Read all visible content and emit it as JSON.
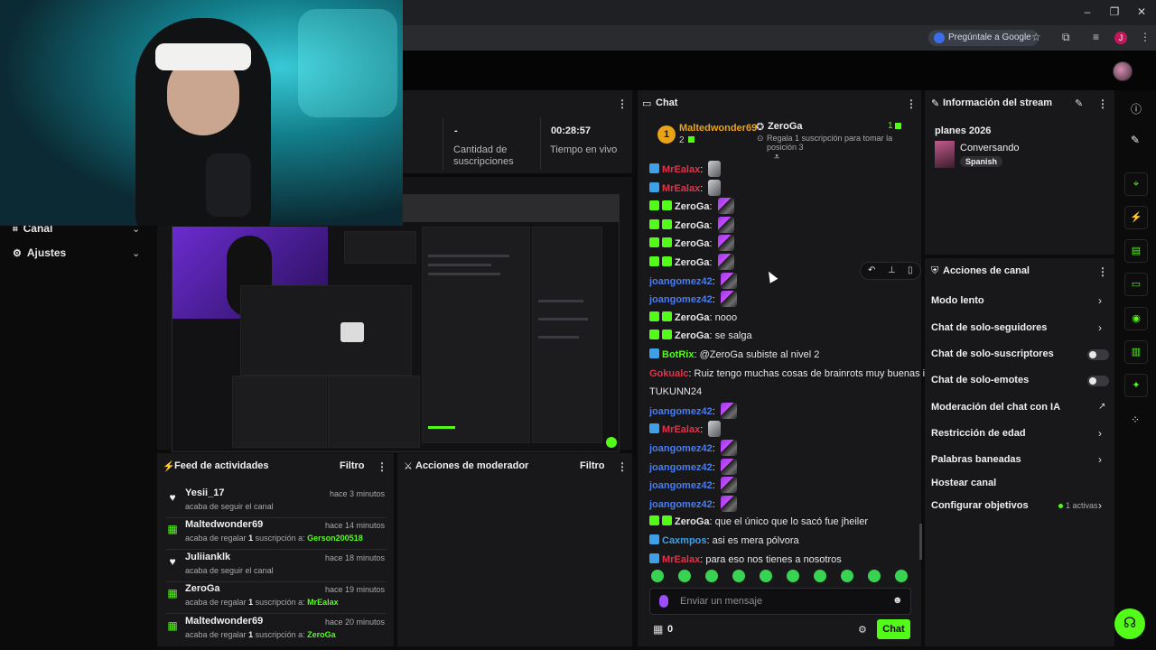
{
  "browser": {
    "ask_google": "Pregúntale a Google",
    "profile_initial": "J"
  },
  "sidebar": {
    "items": [
      {
        "label": "Canal",
        "icon": "channel-icon"
      },
      {
        "label": "Ajustes",
        "icon": "gear-icon"
      }
    ]
  },
  "stats": {
    "subs_value": "-",
    "subs_label": "Cantidad de suscripciones",
    "live_value": "00:28:57",
    "live_label": "Tiempo en vivo"
  },
  "activity_feed": {
    "title": "Feed de actividades",
    "filter": "Filtro",
    "items": [
      {
        "user": "Yesii_17",
        "desc": "acaba de seguir el canal",
        "time": "hace 3 minutos",
        "icon": "heart-icon"
      },
      {
        "user": "Maltedwonder69",
        "desc_pre": "acaba de regalar",
        "count": "1",
        "desc_mid": "suscripción a:",
        "target": "Gerson200518",
        "time": "hace 14 minutos",
        "icon": "gift-icon"
      },
      {
        "user": "Juliianklk",
        "desc": "acaba de seguir el canal",
        "time": "hace 18 minutos",
        "icon": "heart-icon"
      },
      {
        "user": "ZeroGa",
        "desc_pre": "acaba de regalar",
        "count": "1",
        "desc_mid": "suscripción a:",
        "target": "MrEalax",
        "time": "hace 19 minutos",
        "icon": "gift-icon"
      },
      {
        "user": "Maltedwonder69",
        "desc_pre": "acaba de regalar",
        "count": "1",
        "desc_mid": "suscripción a:",
        "target": "ZeroGa",
        "time": "hace 20 minutos",
        "icon": "gift-icon"
      }
    ]
  },
  "moderator": {
    "title": "Acciones de moderador",
    "filter": "Filtro"
  },
  "chat": {
    "title": "Chat",
    "pinned_gifter": {
      "rank": "1",
      "name": "Maltedwonder69",
      "count": "2"
    },
    "pinned_gift": {
      "name": "ZeroGa",
      "count": "1",
      "desc": "Regala 1 suscripción para tomar la posición 3"
    },
    "messages": [
      {
        "user": "MrEalax",
        "color": "#e0334a",
        "text": "",
        "badge": "b-blue",
        "emote": "gray"
      },
      {
        "user": "MrEalax",
        "color": "#e0334a",
        "text": "",
        "badge": "b-blue",
        "emote": "gray"
      },
      {
        "user": "ZeroGa",
        "color": "#e6e6e8",
        "text": "",
        "badge": "b-sub",
        "emote": "purple"
      },
      {
        "user": "ZeroGa",
        "color": "#e6e6e8",
        "text": "",
        "badge": "b-sub",
        "emote": "purple"
      },
      {
        "user": "ZeroGa",
        "color": "#e6e6e8",
        "text": "",
        "badge": "b-sub",
        "emote": "purple"
      },
      {
        "user": "ZeroGa",
        "color": "#e6e6e8",
        "text": "",
        "badge": "b-sub",
        "emote": "purple"
      },
      {
        "user": "joangomez42",
        "color": "#4a7cf0",
        "text": "",
        "badge": "",
        "emote": "purple"
      },
      {
        "user": "joangomez42",
        "color": "#4a7cf0",
        "text": "",
        "badge": "",
        "emote": "purple"
      },
      {
        "user": "ZeroGa",
        "color": "#e6e6e8",
        "text": "nooo",
        "badge": "b-sub",
        "emote": ""
      },
      {
        "user": "ZeroGa",
        "color": "#e6e6e8",
        "text": "se salga",
        "badge": "b-sub",
        "emote": ""
      },
      {
        "user": "BotRix",
        "color": "#53fc18",
        "text": "@ZeroGa subiste al nivel 2",
        "badge": "b-blue",
        "emote": ""
      },
      {
        "user": "Gokualc",
        "color": "#e0334a",
        "text": "Ruiz tengo muchas cosas de brainrots muy buenas id",
        "badge": "",
        "emote": ""
      },
      {
        "user": "",
        "color": "#e6e6e8",
        "text": "TUKUNN24",
        "badge": "",
        "emote": ""
      },
      {
        "user": "joangomez42",
        "color": "#4a7cf0",
        "text": "",
        "badge": "",
        "emote": "purple"
      },
      {
        "user": "MrEalax",
        "color": "#e0334a",
        "text": "",
        "badge": "b-blue",
        "emote": "gray"
      },
      {
        "user": "joangomez42",
        "color": "#4a7cf0",
        "text": "",
        "badge": "",
        "emote": "purple"
      },
      {
        "user": "joangomez42",
        "color": "#4a7cf0",
        "text": "",
        "badge": "",
        "emote": "purple"
      },
      {
        "user": "joangomez42",
        "color": "#4a7cf0",
        "text": "",
        "badge": "",
        "emote": "purple"
      },
      {
        "user": "joangomez42",
        "color": "#4a7cf0",
        "text": "",
        "badge": "",
        "emote": "purple"
      },
      {
        "user": "ZeroGa",
        "color": "#e6e6e8",
        "text": "que el único que lo sacó fue jheiler",
        "badge": "b-sub",
        "emote": ""
      },
      {
        "user": "Caxmpos",
        "color": "#3da0e8",
        "text": "asi es mera pólvora",
        "badge": "b-blue",
        "emote": ""
      },
      {
        "user": "MrEalax",
        "color": "#e0334a",
        "text": "para eso nos tienes a nosotros",
        "badge": "b-blue",
        "emote": ""
      }
    ],
    "input_placeholder": "Enviar un mensaje",
    "viewer_count": "0",
    "send_label": "Chat"
  },
  "stream_info": {
    "title": "Información del stream",
    "stream_title": "planes 2026",
    "category": "Conversando",
    "language": "Spanish"
  },
  "channel_actions": {
    "title": "Acciones de canal",
    "items": [
      {
        "label": "Modo lento",
        "control": "chevron"
      },
      {
        "label": "Chat de solo-seguidores",
        "control": "chevron"
      },
      {
        "label": "Chat de solo-suscriptores",
        "control": "toggle"
      },
      {
        "label": "Chat de solo-emotes",
        "control": "toggle"
      },
      {
        "label": "Moderación del chat con IA",
        "control": "external"
      },
      {
        "label": "Restricción de edad",
        "control": "chevron"
      },
      {
        "label": "Palabras baneadas",
        "control": "chevron"
      },
      {
        "label": "Hostear canal",
        "control": "none"
      },
      {
        "label": "Configurar objetivos",
        "control": "chevron"
      }
    ],
    "objectives_active": "1 activas"
  },
  "colors": {
    "accent": "#53fc18",
    "panel": "#18181a",
    "background": "#0b0b0c"
  }
}
